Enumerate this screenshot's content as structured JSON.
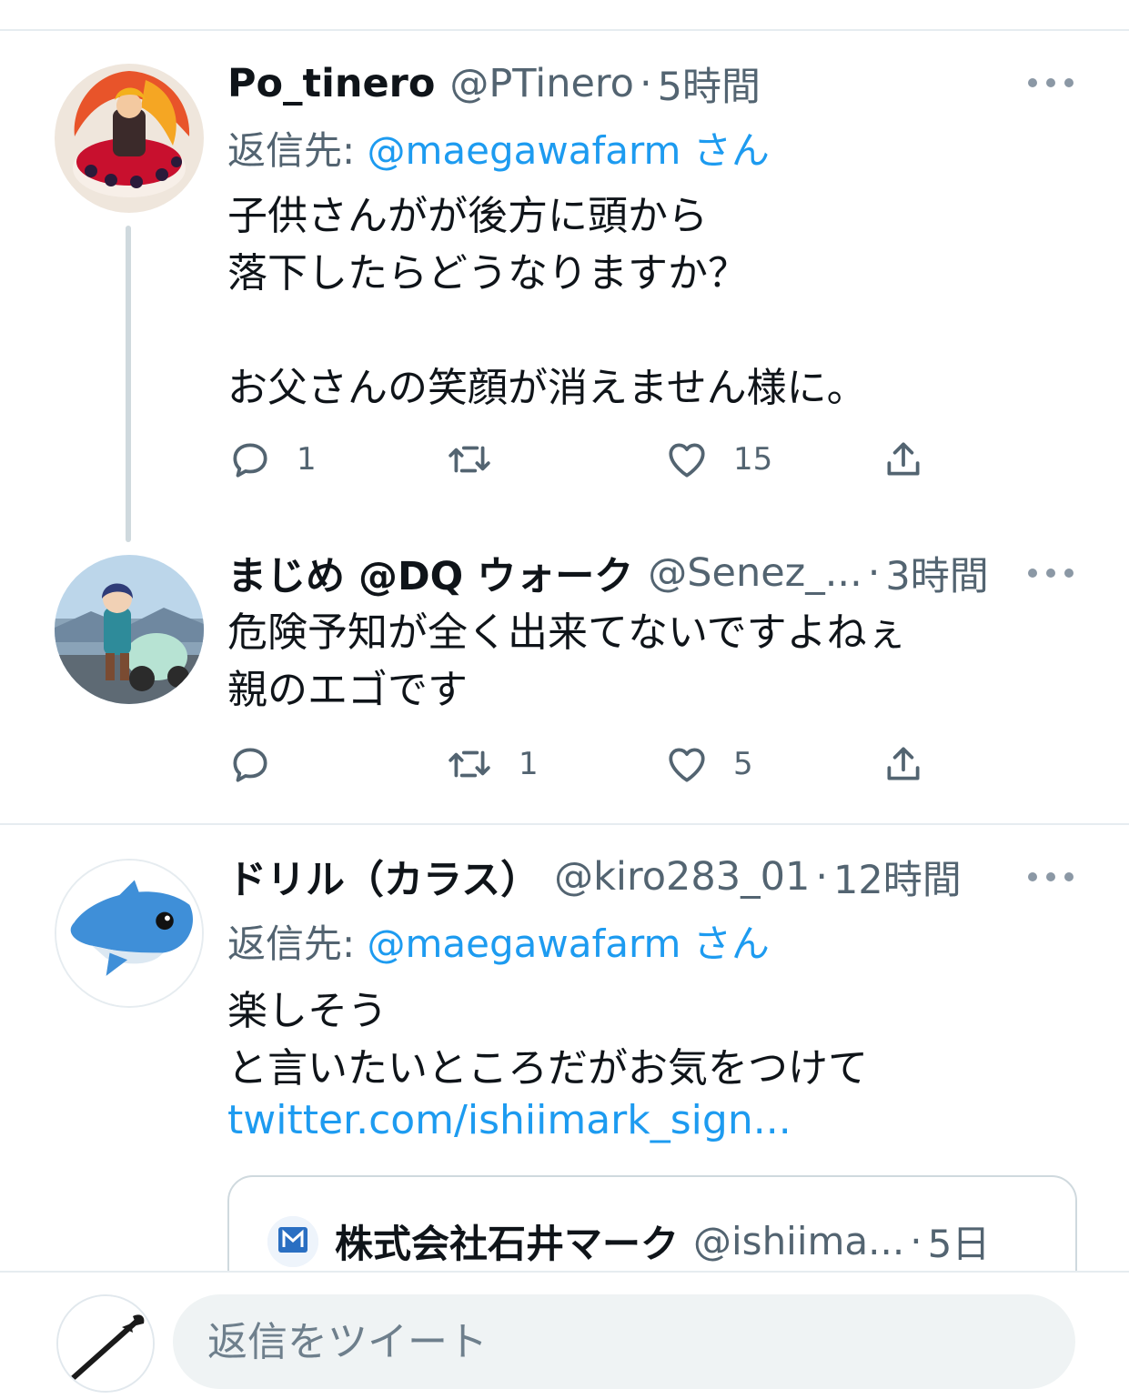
{
  "tweets": [
    {
      "name": "Po_tinero",
      "handle": "@PTinero",
      "separator": "·",
      "time": "5時間",
      "reply_prefix": "返信先: ",
      "reply_mention": "@maegawafarm",
      "reply_suffix": " さん",
      "text": "子供さんがが後方に頭から\n落下したらどうなりますか？\n\nお父さんの笑顔が消えません様に。",
      "reply_count": "1",
      "retweet_count": "",
      "like_count": "15"
    },
    {
      "name": "まじめ @DQ ウォーク",
      "handle": "@Senez_...",
      "separator": "·",
      "time": "3時間",
      "text": "危険予知が全く出来てないですよねぇ\n親のエゴです",
      "reply_count": "",
      "retweet_count": "1",
      "like_count": "5"
    },
    {
      "name": "ドリル（カラス）",
      "handle": "@kiro283_01",
      "separator": "·",
      "time": "12時間",
      "reply_prefix": "返信先: ",
      "reply_mention": "@maegawafarm",
      "reply_suffix": " さん",
      "text": "楽しそう\nと言いたいところだがお気をつけて",
      "link": "twitter.com/ishiimark_sign...",
      "quote": {
        "name": "株式会社石井マーク",
        "handle": "@ishiima...",
        "separator": "·",
        "time": "5日"
      }
    }
  ],
  "composer": {
    "placeholder": "返信をツイート"
  },
  "colors": {
    "accent": "#1d9bf0",
    "secondary_text": "#536471",
    "divider": "#e6ecf0"
  },
  "icons": [
    "reply-icon",
    "retweet-icon",
    "like-icon",
    "share-icon",
    "more-icon"
  ]
}
